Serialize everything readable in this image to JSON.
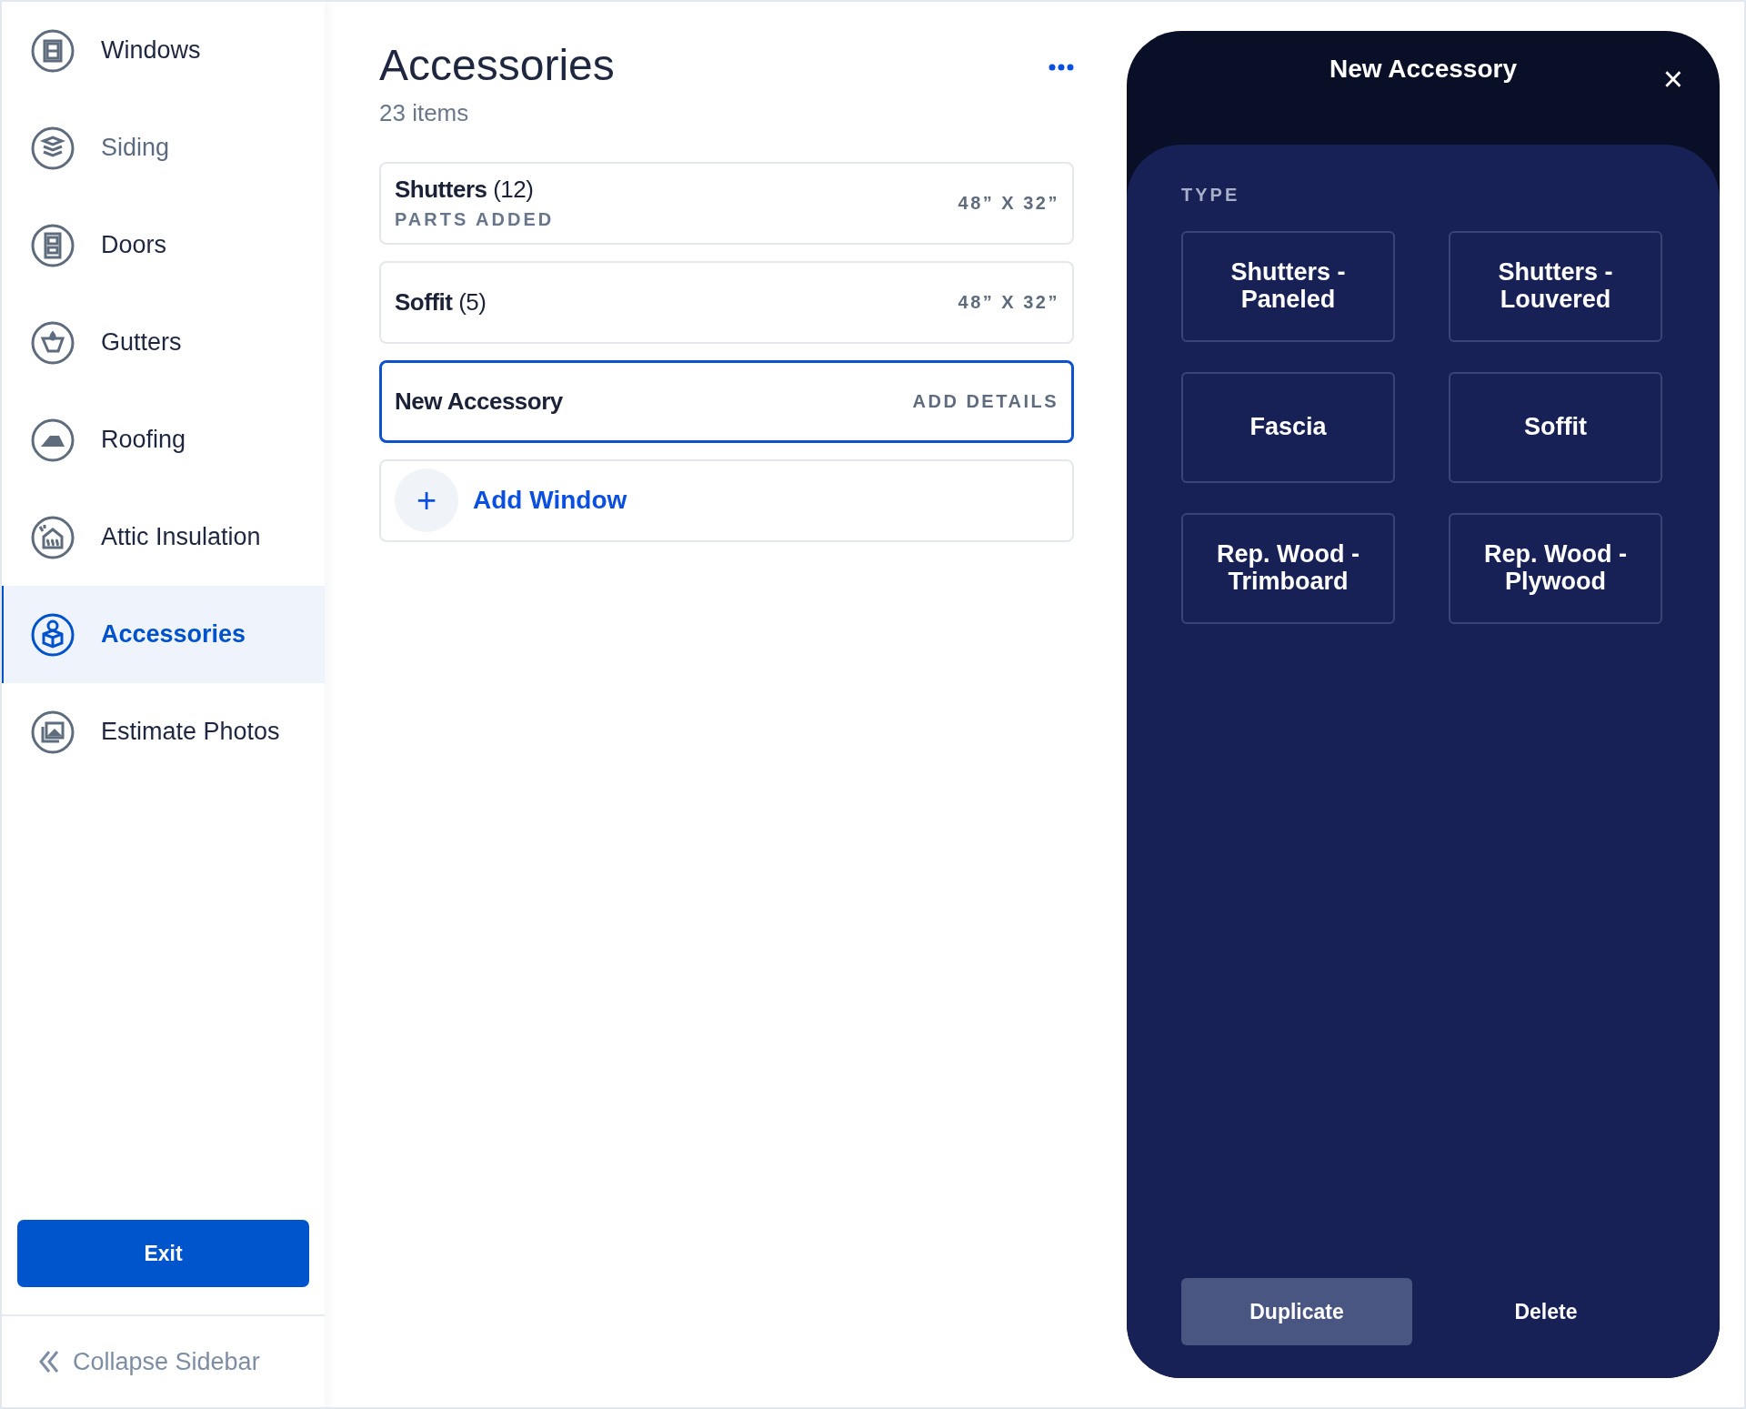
{
  "sidebar": {
    "items": [
      {
        "label": "Windows",
        "kind": "window",
        "selected": false,
        "disabled": false
      },
      {
        "label": "Siding",
        "kind": "siding",
        "selected": false,
        "disabled": true
      },
      {
        "label": "Doors",
        "kind": "door",
        "selected": false,
        "disabled": false
      },
      {
        "label": "Gutters",
        "kind": "gutter",
        "selected": false,
        "disabled": false
      },
      {
        "label": "Roofing",
        "kind": "roof",
        "selected": false,
        "disabled": false
      },
      {
        "label": "Attic Insulation",
        "kind": "attic",
        "selected": false,
        "disabled": false
      },
      {
        "label": "Accessories",
        "kind": "box",
        "selected": true,
        "disabled": false
      },
      {
        "label": "Estimate Photos",
        "kind": "photo",
        "selected": false,
        "disabled": false
      }
    ],
    "exit_button": "Exit",
    "collapse": "Collapse Sidebar"
  },
  "main": {
    "title": "Accessories",
    "count": "23 items",
    "cards": [
      {
        "name": "Shutters",
        "qty": "(12)",
        "status": "PARTS ADDED",
        "size": "48” X 32”",
        "selected": false
      },
      {
        "name": "Soffit",
        "qty": "(5)",
        "size": "48” X 32”",
        "selected": false
      },
      {
        "name": "New Accessory",
        "size": "ADD DETAILS",
        "selected": true
      }
    ],
    "add_button": {
      "icon": "+",
      "label": "Add Window"
    }
  },
  "panel": {
    "title": "New Accessory",
    "close": "×",
    "section": "TYPE",
    "types": [
      "Shutters - Paneled",
      "Shutters - Louvered",
      "Fascia",
      "Soffit",
      "Rep. Wood - Trimboard",
      "Rep. Wood - Plywood"
    ],
    "buttons": [
      {
        "label": "Duplicate",
        "kind": "filled"
      },
      {
        "label": "Delete",
        "kind": "plain"
      }
    ]
  }
}
